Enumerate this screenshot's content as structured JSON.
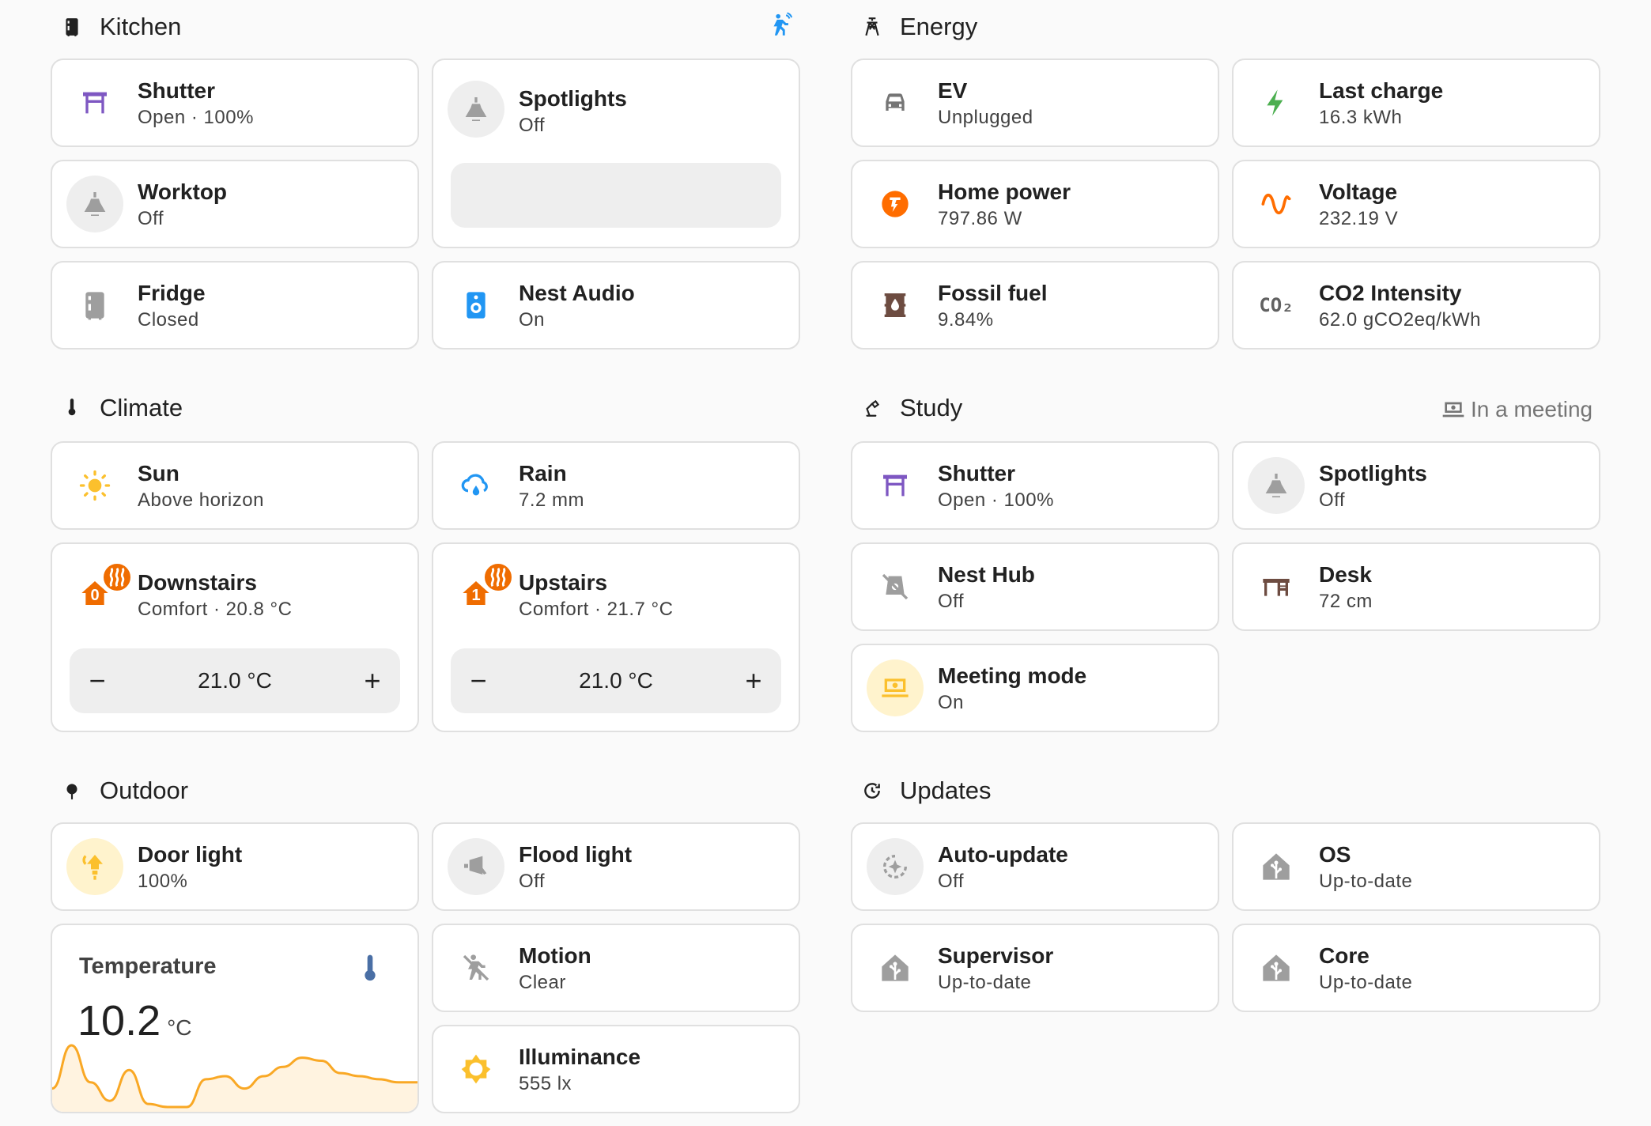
{
  "kitchen": {
    "title": "Kitchen",
    "shutter": {
      "name": "Shutter",
      "state": "Open · 100%"
    },
    "spotlights": {
      "name": "Spotlights",
      "state": "Off"
    },
    "worktop": {
      "name": "Worktop",
      "state": "Off"
    },
    "fridge": {
      "name": "Fridge",
      "state": "Closed"
    },
    "nest_audio": {
      "name": "Nest Audio",
      "state": "On"
    }
  },
  "energy": {
    "title": "Energy",
    "ev": {
      "name": "EV",
      "state": "Unplugged"
    },
    "last_charge": {
      "name": "Last charge",
      "state": "16.3 kWh"
    },
    "home_power": {
      "name": "Home power",
      "state": "797.86 W"
    },
    "voltage": {
      "name": "Voltage",
      "state": "232.19 V"
    },
    "fossil_fuel": {
      "name": "Fossil fuel",
      "state": "9.84%"
    },
    "co2": {
      "name": "CO2 Intensity",
      "state": "62.0 gCO2eq/kWh",
      "icon_text": "CO₂"
    }
  },
  "climate": {
    "title": "Climate",
    "sun": {
      "name": "Sun",
      "state": "Above horizon"
    },
    "rain": {
      "name": "Rain",
      "state": "7.2 mm"
    },
    "downstairs": {
      "name": "Downstairs",
      "state": "Comfort · 20.8 °C",
      "setpoint": "21.0 °C",
      "floor": "0"
    },
    "upstairs": {
      "name": "Upstairs",
      "state": "Comfort · 21.7 °C",
      "setpoint": "21.0 °C",
      "floor": "1"
    },
    "minus": "−",
    "plus": "+"
  },
  "study": {
    "title": "Study",
    "badge": "In a meeting",
    "shutter": {
      "name": "Shutter",
      "state": "Open · 100%"
    },
    "spotlights": {
      "name": "Spotlights",
      "state": "Off"
    },
    "nest_hub": {
      "name": "Nest Hub",
      "state": "Off"
    },
    "desk": {
      "name": "Desk",
      "state": "72 cm"
    },
    "meeting_mode": {
      "name": "Meeting mode",
      "state": "On"
    }
  },
  "outdoor": {
    "title": "Outdoor",
    "door_light": {
      "name": "Door light",
      "state": "100%"
    },
    "flood_light": {
      "name": "Flood light",
      "state": "Off"
    },
    "temperature": {
      "name": "Temperature",
      "value": "10.2",
      "unit": "°C"
    },
    "motion": {
      "name": "Motion",
      "state": "Clear"
    },
    "illuminance": {
      "name": "Illuminance",
      "state": "555 lx"
    }
  },
  "updates": {
    "title": "Updates",
    "auto_update": {
      "name": "Auto-update",
      "state": "Off"
    },
    "os": {
      "name": "OS",
      "state": "Up-to-date"
    },
    "supervisor": {
      "name": "Supervisor",
      "state": "Up-to-date"
    },
    "core": {
      "name": "Core",
      "state": "Up-to-date"
    }
  },
  "colors": {
    "shutter": "#7e57c2",
    "light_off": "#9e9e9e",
    "light_on": "#fbc02d",
    "heat": "#ef6c00",
    "info": "#2196f3",
    "energy": "#4caf50",
    "fossil": "#6d4c41",
    "temp": "#4a6fa5"
  },
  "temperature_history": [
    10.4,
    11.8,
    10.6,
    10.0,
    11.0,
    9.9,
    9.8,
    9.8,
    10.7,
    10.8,
    10.4,
    10.8,
    11.1,
    11.4,
    11.3,
    10.9,
    10.8,
    10.7,
    10.6,
    10.6
  ]
}
